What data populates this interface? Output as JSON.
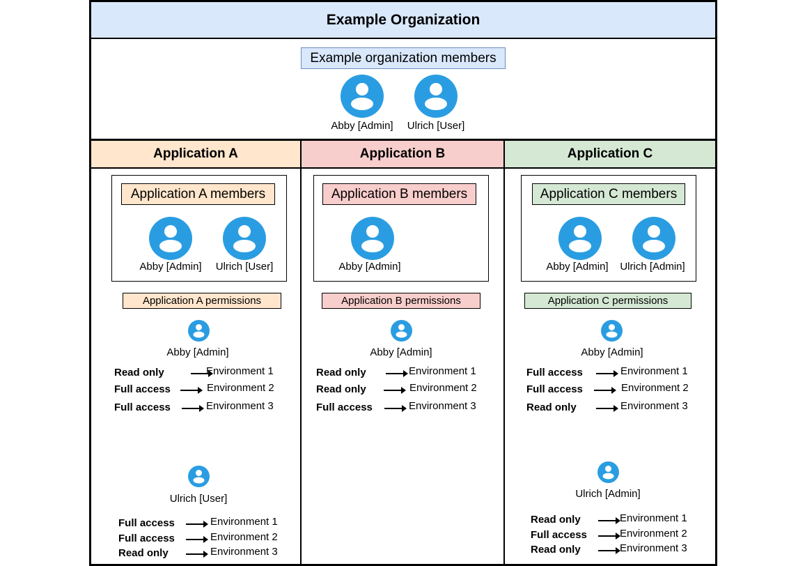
{
  "organization": {
    "title": "Example Organization",
    "members_label": "Example organization members",
    "members": [
      {
        "label": "Abby [Admin]"
      },
      {
        "label": "Ulrich [User]"
      }
    ]
  },
  "icon_color": "#2a9de2",
  "applications": [
    {
      "title": "Application A",
      "accent": "#ffe6cc",
      "members_label": "Application A members",
      "members": [
        {
          "label": "Abby [Admin]"
        },
        {
          "label": "Ulrich [User]"
        }
      ],
      "permissions_label": "Application A permissions",
      "permissions": [
        {
          "member": "Abby [Admin]",
          "rows": [
            {
              "level": "Read only",
              "env": "Environment 1"
            },
            {
              "level": "Full access",
              "env": "Environment 2"
            },
            {
              "level": "Full access",
              "env": "Environment 3"
            }
          ]
        },
        {
          "member": "Ulrich [User]",
          "rows": [
            {
              "level": "Full access",
              "env": "Environment 1"
            },
            {
              "level": "Full access",
              "env": "Environment 2"
            },
            {
              "level": "Read only",
              "env": "Environment 3"
            }
          ]
        }
      ]
    },
    {
      "title": "Application B",
      "accent": "#f8cecc",
      "members_label": "Application B members",
      "members": [
        {
          "label": "Abby [Admin]"
        }
      ],
      "permissions_label": "Application B permissions",
      "permissions": [
        {
          "member": "Abby [Admin]",
          "rows": [
            {
              "level": "Read only",
              "env": "Environment 1"
            },
            {
              "level": "Read only",
              "env": "Environment 2"
            },
            {
              "level": "Full access",
              "env": "Environment 3"
            }
          ]
        }
      ]
    },
    {
      "title": "Application C",
      "accent": "#d5e8d4",
      "members_label": "Application C members",
      "members": [
        {
          "label": "Abby [Admin]"
        },
        {
          "label": "Ulrich [Admin]"
        }
      ],
      "permissions_label": "Application C permissions",
      "permissions": [
        {
          "member": "Abby [Admin]",
          "rows": [
            {
              "level": "Full access",
              "env": "Environment 1"
            },
            {
              "level": "Full access",
              "env": "Environment 2"
            },
            {
              "level": "Read only",
              "env": "Environment 3"
            }
          ]
        },
        {
          "member": "Ulrich [Admin]",
          "rows": [
            {
              "level": "Read only",
              "env": "Environment 1"
            },
            {
              "level": "Full access",
              "env": "Environment 2"
            },
            {
              "level": "Read only",
              "env": "Environment 3"
            }
          ]
        }
      ]
    }
  ]
}
